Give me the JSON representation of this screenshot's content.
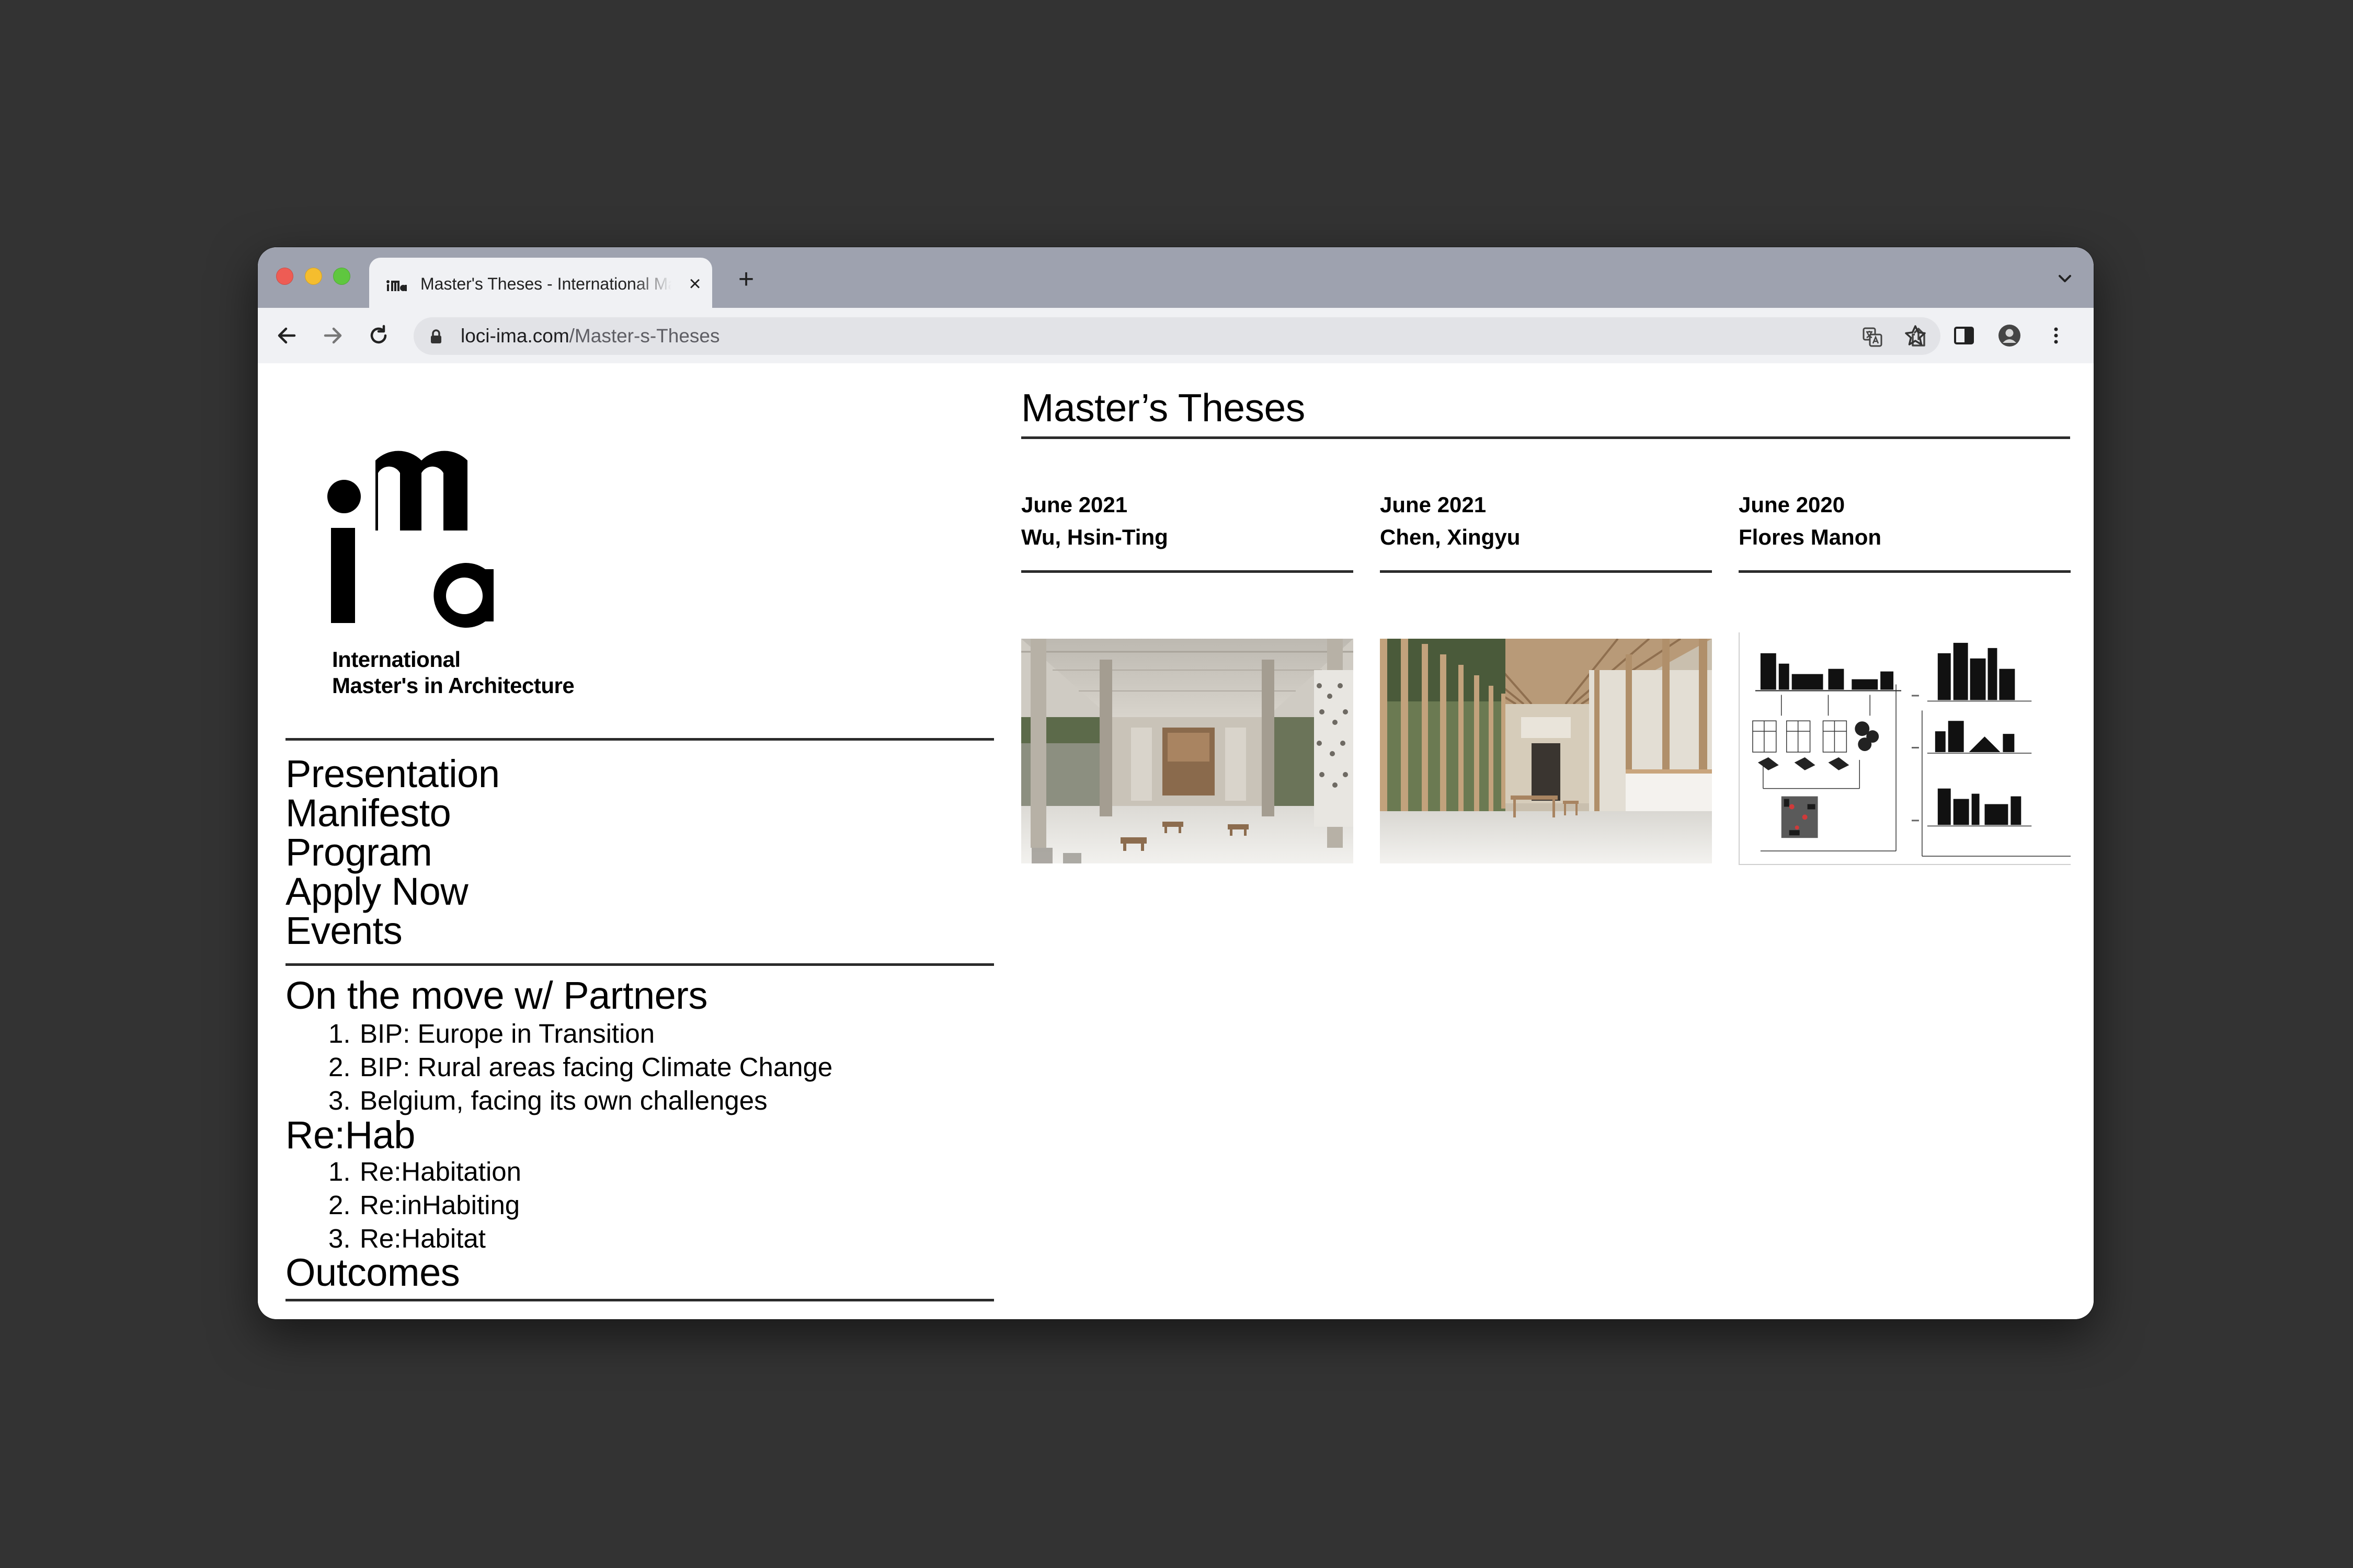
{
  "browser": {
    "tab_title": "Master's Theses - International Master's in Architecture",
    "tab_close": "×",
    "new_tab": "+",
    "url_domain": "loci-ima.com",
    "url_path": "/Master-s-Theses"
  },
  "brand": {
    "logo_text": "ima",
    "caption_line1": "International",
    "caption_line2": "Master's in Architecture"
  },
  "nav": {
    "primary": [
      "Presentation",
      "Manifesto",
      "Program",
      "Apply Now",
      "Events"
    ],
    "on_the_move": {
      "title": "On the move w/ Partners",
      "items": [
        {
          "num": "1.",
          "label": "BIP: Europe in Transition"
        },
        {
          "num": "2.",
          "label": "BIP: Rural areas facing Climate Change"
        },
        {
          "num": "3.",
          "label": "Belgium, facing its own challenges"
        }
      ]
    },
    "rehab": {
      "title": "Re:Hab",
      "items": [
        {
          "num": "1.",
          "label": "Re:Habitation"
        },
        {
          "num": "2.",
          "label": "Re:inHabiting"
        },
        {
          "num": "3.",
          "label": "Re:Habitat"
        }
      ]
    },
    "outcomes": "Outcomes"
  },
  "main": {
    "title": "Master’s Theses",
    "theses": [
      {
        "date": "June 2021",
        "author": "Wu, Hsin-Ting",
        "image": "interior-render-concrete-hall"
      },
      {
        "date": "June 2021",
        "author": "Chen, Xingyu",
        "image": "interior-render-timber-gallery"
      },
      {
        "date": "June 2020",
        "author": "Flores Manon",
        "image": "architectural-drawings-sheet"
      }
    ]
  },
  "icons": {
    "back": "arrow-left-icon",
    "forward": "arrow-right-icon",
    "reload": "reload-icon",
    "lock": "lock-icon",
    "translate": "translate-icon",
    "share": "share-icon",
    "bookmark": "star-icon",
    "sidepanel": "side-panel-icon",
    "profile": "profile-icon",
    "menu": "kebab-menu-icon"
  }
}
